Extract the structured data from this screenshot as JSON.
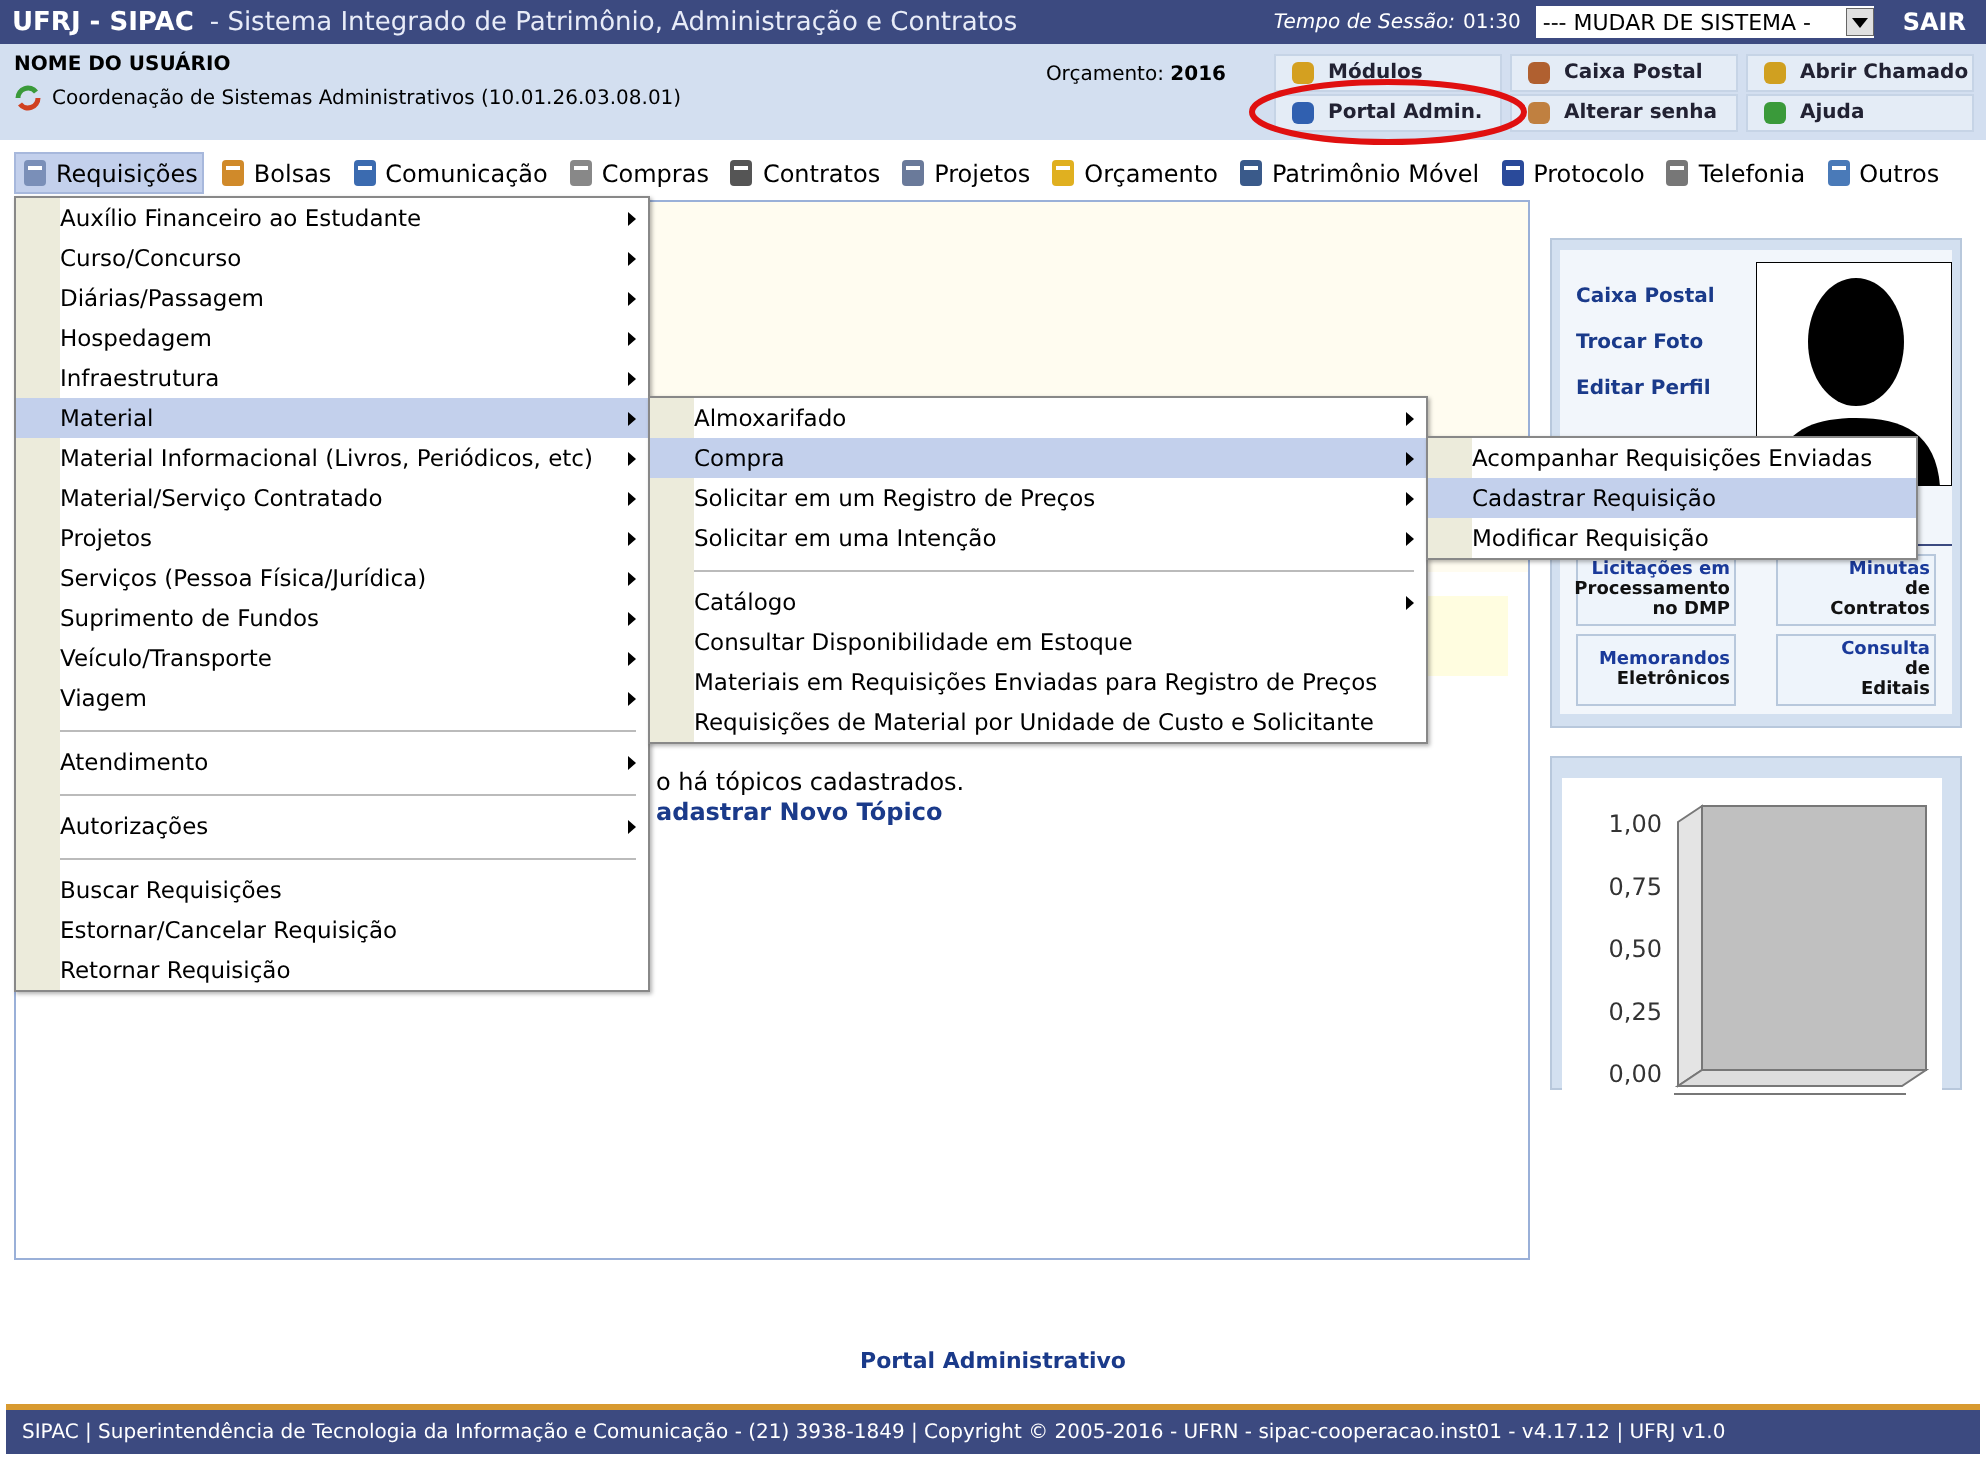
{
  "header": {
    "brand": "UFRJ - SIPAC",
    "subtitle": "- Sistema Integrado de Patrimônio, Administração e Contratos",
    "session_label": "Tempo de Sessão:",
    "session_time": "01:30",
    "system_select": "--- MUDAR DE SISTEMA -",
    "logout": "SAIR"
  },
  "user": {
    "name": "NOME DO USUÁRIO",
    "unit": "Coordenação de Sistemas Administrativos (10.01.26.03.08.01)",
    "budget_label": "Orçamento:",
    "budget_year": "2016"
  },
  "shortcuts": [
    {
      "label": "Módulos",
      "circled": false
    },
    {
      "label": "Caixa Postal",
      "circled": false
    },
    {
      "label": "Abrir Chamado",
      "circled": false
    },
    {
      "label": "Portal Admin.",
      "circled": true
    },
    {
      "label": "Alterar senha",
      "circled": false
    },
    {
      "label": "Ajuda",
      "circled": false
    }
  ],
  "menubar": [
    {
      "label": "Requisições",
      "selected": true
    },
    {
      "label": "Bolsas",
      "selected": false
    },
    {
      "label": "Comunicação",
      "selected": false
    },
    {
      "label": "Compras",
      "selected": false
    },
    {
      "label": "Contratos",
      "selected": false
    },
    {
      "label": "Projetos",
      "selected": false
    },
    {
      "label": "Orçamento",
      "selected": false
    },
    {
      "label": "Patrimônio Móvel",
      "selected": false
    },
    {
      "label": "Protocolo",
      "selected": false
    },
    {
      "label": "Telefonia",
      "selected": false
    },
    {
      "label": "Outros",
      "selected": false
    }
  ],
  "menu": [
    {
      "kind": "item",
      "label": "Auxílio Financeiro ao Estudante",
      "has_submenu": true,
      "selected": false
    },
    {
      "kind": "item",
      "label": "Curso/Concurso",
      "has_submenu": true,
      "selected": false
    },
    {
      "kind": "item",
      "label": "Diárias/Passagem",
      "has_submenu": true,
      "selected": false
    },
    {
      "kind": "item",
      "label": "Hospedagem",
      "has_submenu": true,
      "selected": false
    },
    {
      "kind": "item",
      "label": "Infraestrutura",
      "has_submenu": true,
      "selected": false
    },
    {
      "kind": "item",
      "label": "Material",
      "has_submenu": true,
      "selected": true,
      "children": [
        {
          "kind": "item",
          "label": "Almoxarifado",
          "has_submenu": true,
          "selected": false
        },
        {
          "kind": "item",
          "label": "Compra",
          "has_submenu": true,
          "selected": true,
          "children": [
            {
              "kind": "item",
              "label": "Acompanhar Requisições Enviadas",
              "has_submenu": false,
              "selected": false
            },
            {
              "kind": "item",
              "label": "Cadastrar Requisição",
              "has_submenu": false,
              "selected": true
            },
            {
              "kind": "item",
              "label": "Modificar Requisição",
              "has_submenu": false,
              "selected": false
            }
          ]
        },
        {
          "kind": "item",
          "label": "Solicitar em um Registro de Preços",
          "has_submenu": true,
          "selected": false
        },
        {
          "kind": "item",
          "label": "Solicitar em uma Intenção",
          "has_submenu": true,
          "selected": false
        },
        {
          "kind": "separator"
        },
        {
          "kind": "item",
          "label": "Catálogo",
          "has_submenu": true,
          "selected": false
        },
        {
          "kind": "item",
          "label": "Consultar Disponibilidade em Estoque",
          "has_submenu": false,
          "selected": false
        },
        {
          "kind": "item",
          "label": "Materiais em Requisições Enviadas para Registro de Preços",
          "has_submenu": false,
          "selected": false
        },
        {
          "kind": "item",
          "label": "Requisições de Material por Unidade de Custo e Solicitante",
          "has_submenu": false,
          "selected": false
        }
      ]
    },
    {
      "kind": "item",
      "label": "Material Informacional (Livros, Periódicos, etc)",
      "has_submenu": true,
      "selected": false
    },
    {
      "kind": "item",
      "label": "Material/Serviço Contratado",
      "has_submenu": true,
      "selected": false
    },
    {
      "kind": "item",
      "label": "Projetos",
      "has_submenu": true,
      "selected": false
    },
    {
      "kind": "item",
      "label": "Serviços (Pessoa Física/Jurídica)",
      "has_submenu": true,
      "selected": false
    },
    {
      "kind": "item",
      "label": "Suprimento de Fundos",
      "has_submenu": true,
      "selected": false
    },
    {
      "kind": "item",
      "label": "Veículo/Transporte",
      "has_submenu": true,
      "selected": false
    },
    {
      "kind": "item",
      "label": "Viagem",
      "has_submenu": true,
      "selected": false
    },
    {
      "kind": "separator"
    },
    {
      "kind": "item",
      "label": "Atendimento",
      "has_submenu": true,
      "selected": false
    },
    {
      "kind": "separator"
    },
    {
      "kind": "item",
      "label": "Autorizações",
      "has_submenu": true,
      "selected": false
    },
    {
      "kind": "separator"
    },
    {
      "kind": "item",
      "label": "Buscar Requisições",
      "has_submenu": false,
      "selected": false
    },
    {
      "kind": "item",
      "label": "Estornar/Cancelar Requisição",
      "has_submenu": false,
      "selected": false
    },
    {
      "kind": "item",
      "label": "Retornar Requisição",
      "has_submenu": false,
      "selected": false
    }
  ],
  "forum": {
    "empty_text": "o há tópicos cadastrados.",
    "new_topic_link": "adastrar Novo Tópico"
  },
  "profile": {
    "links": [
      "Caixa Postal",
      "Trocar Foto",
      "Editar Perfil"
    ]
  },
  "tiles": [
    {
      "title": "Licitações em",
      "lines": [
        "Processamento",
        "no DMP"
      ]
    },
    {
      "title": "Minutas",
      "lines": [
        "de",
        "Contratos"
      ]
    },
    {
      "title": "Memorandos",
      "lines": [
        "Eletrônicos"
      ]
    },
    {
      "title": "Consulta",
      "lines": [
        "de",
        "Editais"
      ]
    }
  ],
  "chart": {
    "y_labels": [
      "1,00",
      "0,75",
      "0,50",
      "0,25",
      "0,00"
    ]
  },
  "footer": {
    "portal_link": "Portal Administrativo",
    "credits": "SIPAC | Superintendência de Tecnologia da Informação e Comunicação - (21) 3938-1849 | Copyright © 2005-2016 - UFRN - sipac-cooperacao.inst01 - v4.17.12 | UFRJ v1.0"
  }
}
